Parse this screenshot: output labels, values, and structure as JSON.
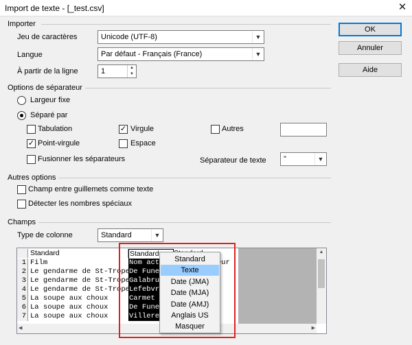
{
  "window": {
    "title": "Import de texte - [_test.csv]"
  },
  "buttons": {
    "ok": "OK",
    "cancel": "Annuler",
    "help": "Aide"
  },
  "importer": {
    "group": "Importer",
    "charset_label": "Jeu de caractères",
    "charset_value": "Unicode (UTF-8)",
    "language_label": "Langue",
    "language_value": "Par défaut - Français (France)",
    "from_line_label": "À partir de la ligne",
    "from_line_value": "1"
  },
  "separator": {
    "group": "Options de séparateur",
    "fixed_width": "Largeur fixe",
    "separated_by": "Séparé par",
    "tab": "Tabulation",
    "comma": "Virgule",
    "others": "Autres",
    "semicolon": "Point-virgule",
    "space": "Espace",
    "merge": "Fusionner les séparateurs",
    "text_sep_label": "Séparateur de texte",
    "text_sep_value": "\""
  },
  "other_options": {
    "group": "Autres options",
    "quoted_as_text": "Champ entre guillemets comme texte",
    "detect_special": "Détecter les nombres spéciaux"
  },
  "fields": {
    "group": "Champs",
    "column_type_label": "Type de colonne",
    "column_type_value": "Standard"
  },
  "preview": {
    "headers": [
      "Standard",
      "Standard",
      "Standard"
    ],
    "rows": [
      {
        "n": "1",
        "c1": "Film",
        "c2": "Nom acteur",
        "c3": "Prénom acteur"
      },
      {
        "n": "2",
        "c1": "Le gendarme de St-Tropez",
        "c2": "De Funes",
        "c3": ""
      },
      {
        "n": "3",
        "c1": "Le gendarme de St-Tropez",
        "c2": "Galabru",
        "c3": ""
      },
      {
        "n": "4",
        "c1": "Le gendarme de St-Tropez",
        "c2": "Lefebvre",
        "c3": ""
      },
      {
        "n": "5",
        "c1": "La soupe aux choux",
        "c2": "Carmet",
        "c3": ""
      },
      {
        "n": "6",
        "c1": "La soupe aux choux",
        "c2": "De Funes",
        "c3": ""
      },
      {
        "n": "7",
        "c1": "La soupe aux choux",
        "c2": "Villeret",
        "c3": ""
      }
    ]
  },
  "dropdown_menu": {
    "items": [
      "Standard",
      "Texte",
      "Date (JMA)",
      "Date (MJA)",
      "Date (AMJ)",
      "Anglais US",
      "Masquer"
    ],
    "selected_index": 1
  },
  "colors": {
    "highlight": "#99ccff",
    "annotation_box": "#e02020",
    "default_button_border": "#0078d7"
  }
}
